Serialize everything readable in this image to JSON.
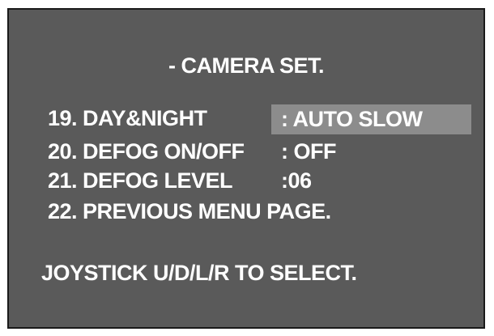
{
  "osd": {
    "title": "- CAMERA SET.",
    "items": [
      {
        "label": "19. DAY&NIGHT",
        "value": ": AUTO SLOW",
        "selected": true
      },
      {
        "label": "20. DEFOG ON/OFF",
        "value": ": OFF"
      },
      {
        "label": "21. DEFOG LEVEL",
        "value": ":06"
      },
      {
        "label": "22. PREVIOUS MENU PAGE."
      }
    ],
    "hint": "JOYSTICK U/D/L/R TO SELECT.",
    "colors": {
      "background": "#5a5a5a",
      "highlight": "#8c8c8c",
      "text": "#ffffff",
      "border": "#1a1a1a"
    }
  }
}
